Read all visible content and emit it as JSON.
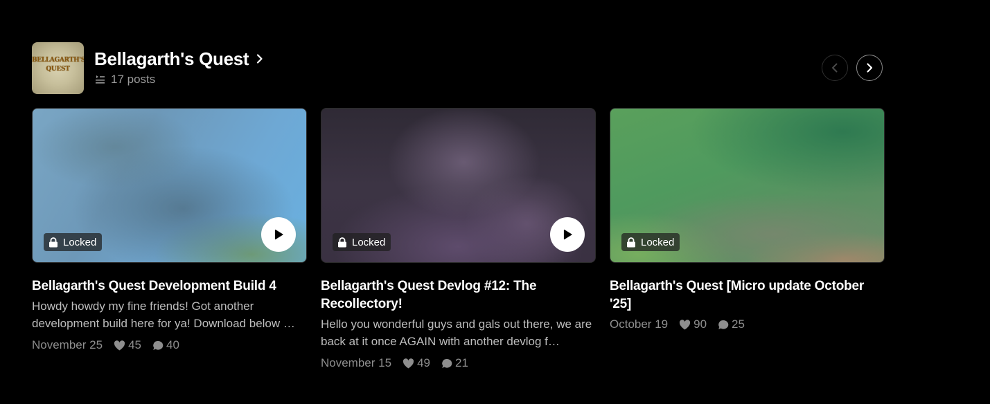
{
  "collection": {
    "title": "Bellagarth's Quest",
    "thumbnail_text_line1": "BELLAGARTH'S",
    "thumbnail_text_line2": "QUEST",
    "post_count": "17 posts",
    "title_icon": "chevron-right-icon",
    "count_icon": "post-list-icon"
  },
  "carousel": {
    "prev_icon": "chevron-left-icon",
    "next_icon": "chevron-right-icon"
  },
  "colors": {
    "background": "#000000",
    "text_primary": "#ffffff",
    "text_secondary": "#bdbdbd",
    "text_muted": "#8e8e8e"
  },
  "posts": [
    {
      "locked_label": "Locked",
      "has_video": true,
      "title": "Bellagarth's Quest Development Build 4",
      "excerpt": "Howdy howdy my fine friends! Got another development build here for ya! Download below …",
      "date": "November 25",
      "likes": "45",
      "comments": "40"
    },
    {
      "locked_label": "Locked",
      "has_video": true,
      "title": "Bellagarth's Quest Devlog #12: The Recollectory!",
      "excerpt": "Hello you wonderful guys and gals out there, we are back at it once AGAIN with another devlog f…",
      "date": "November 15",
      "likes": "49",
      "comments": "21"
    },
    {
      "locked_label": "Locked",
      "has_video": false,
      "title": "Bellagarth's Quest [Micro update October '25]",
      "excerpt": "",
      "date": "October 19",
      "likes": "90",
      "comments": "25"
    }
  ]
}
